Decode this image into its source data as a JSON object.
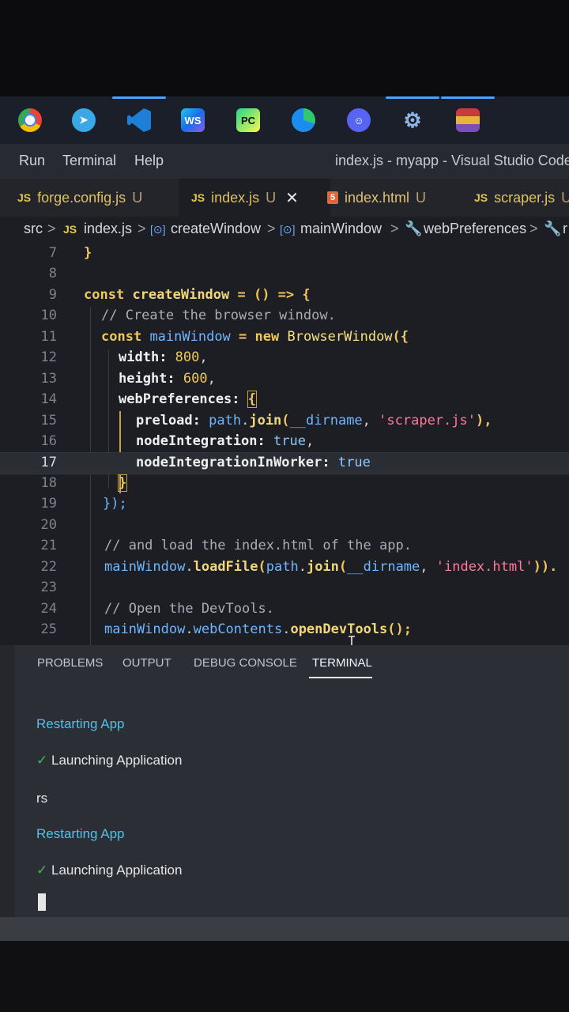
{
  "taskbar": {
    "apps": [
      {
        "icon": "chrome-icon",
        "label": ""
      },
      {
        "icon": "telegram-icon",
        "label": ""
      },
      {
        "icon": "vscode-icon",
        "label": ""
      },
      {
        "icon": "webstorm-icon",
        "label": "WS"
      },
      {
        "icon": "pycharm-icon",
        "label": "PC"
      },
      {
        "icon": "edge-icon",
        "label": ""
      },
      {
        "icon": "discord-icon",
        "label": ""
      },
      {
        "icon": "settings-gear-icon",
        "label": ""
      },
      {
        "icon": "winrar-icon",
        "label": ""
      }
    ]
  },
  "menubar": {
    "run": "Run",
    "terminal": "Terminal",
    "help": "Help",
    "title": "index.js - myapp - Visual Studio Code [A"
  },
  "tabs": [
    {
      "icon": "JS",
      "label": "forge.config.js",
      "status": "U"
    },
    {
      "icon": "JS",
      "label": "index.js",
      "status": "U",
      "close": "✕"
    },
    {
      "icon": "5",
      "label": "index.html",
      "status": "U"
    },
    {
      "icon": "JS",
      "label": "scraper.js",
      "status": "U"
    }
  ],
  "breadcrumb": {
    "folder": "src",
    "file_icon": "JS",
    "file": "index.js",
    "sym_icon": "[⊙]",
    "fn": "createWindow",
    "var": "mainWindow",
    "prop": "webPreferences",
    "more": "r"
  },
  "editor": {
    "line_numbers": [
      "7",
      "8",
      "9",
      "10",
      "11",
      "12",
      "13",
      "14",
      "15",
      "16",
      "17",
      "18",
      "19",
      "20",
      "21",
      "22",
      "23",
      "24",
      "25"
    ],
    "current_line": "17",
    "lines": {
      "l7": {
        "brace": "}"
      },
      "l9": {
        "kw": "const",
        "name": "createWindow",
        "rest": " = () => {"
      },
      "l10": {
        "comment": "// Create the browser window."
      },
      "l11": {
        "kw": "const",
        "name": "mainWindow",
        "op": " = ",
        "new": "new",
        "cls": "BrowserWindow",
        "rest": "({"
      },
      "l12": {
        "prop": "width",
        "colon": ": ",
        "num": "800",
        "comma": ","
      },
      "l13": {
        "prop": "height",
        "colon": ": ",
        "num": "600",
        "comma": ","
      },
      "l14": {
        "prop": "webPreferences",
        "colon": ": ",
        "brace": "{"
      },
      "l15": {
        "prop": "preload",
        "colon": ": ",
        "obj": "path",
        "dot": ".",
        "fn": "join",
        "open": "(",
        "arg": "__dirname",
        "sep": ", ",
        "str": "'scraper.js'",
        "close": "),"
      },
      "l16": {
        "prop": "nodeIntegration",
        "colon": ": ",
        "bool": "true",
        "comma": ","
      },
      "l17": {
        "prop": "nodeIntegrationInWorker",
        "colon": ": ",
        "bool": "true"
      },
      "l18": {
        "brace": "}"
      },
      "l19": {
        "close": "});"
      },
      "l21": {
        "comment": "// and load the index.html of the app."
      },
      "l22": {
        "obj": "mainWindow",
        "dot": ".",
        "fn": "loadFile",
        "open": "(",
        "obj2": "path",
        "dot2": ".",
        "fn2": "join",
        "open2": "(",
        "arg": "__dirname",
        "sep": ", ",
        "str": "'index.html'",
        "close": "))."
      },
      "l24": {
        "comment": "// Open the DevTools."
      },
      "l25": {
        "obj": "mainWindow",
        "dot": ".",
        "obj2": "webContents",
        "dot2": ".",
        "fn": "openDevTools",
        "close": "();"
      }
    }
  },
  "panel": {
    "tabs": [
      "PROBLEMS",
      "OUTPUT",
      "DEBUG CONSOLE",
      "TERMINAL"
    ],
    "active_tab": "TERMINAL",
    "terminal_lines": [
      {
        "check": "",
        "text": "Restarting App",
        "color": "cyan"
      },
      {
        "check": "✓",
        "text": "Launching Application",
        "color": "white"
      },
      {
        "check": "",
        "text": "rs",
        "color": "white"
      },
      {
        "check": "",
        "text": "Restarting App",
        "color": "cyan"
      },
      {
        "check": "✓",
        "text": "Launching Application",
        "color": "white"
      }
    ]
  }
}
